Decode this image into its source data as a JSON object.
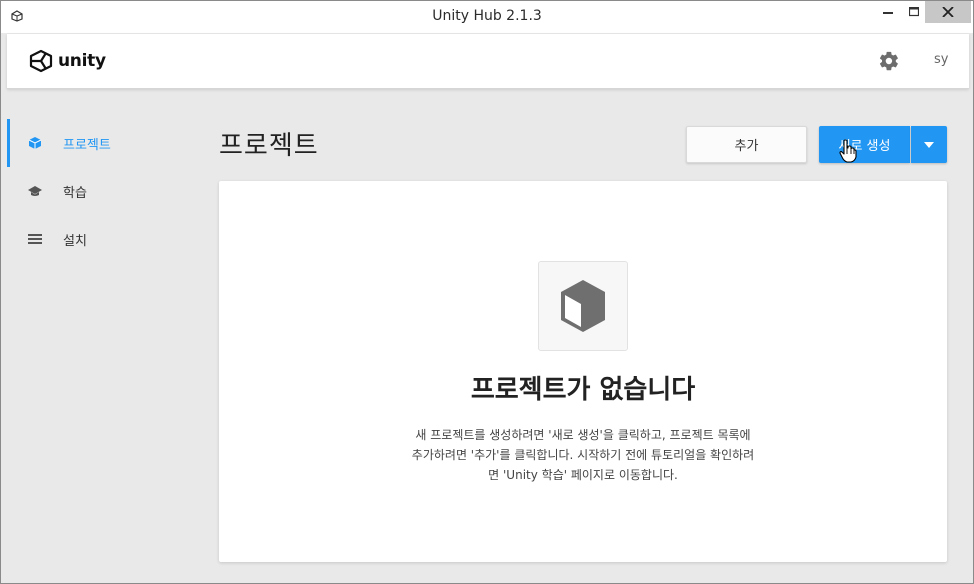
{
  "window": {
    "title": "Unity Hub 2.1.3"
  },
  "header": {
    "logo_text": "unity",
    "user_initials": "sy"
  },
  "sidebar": {
    "items": [
      {
        "label": "프로젝트",
        "icon": "cube-icon",
        "active": true
      },
      {
        "label": "학습",
        "icon": "graduation-cap-icon",
        "active": false
      },
      {
        "label": "설치",
        "icon": "list-icon",
        "active": false
      }
    ]
  },
  "main": {
    "title": "프로젝트",
    "add_button_label": "추가",
    "new_button_label": "새로 생성"
  },
  "empty_state": {
    "title": "프로젝트가 없습니다",
    "description_line1": "새 프로젝트를 생성하려면 '새로 생성'을 클릭하고, 프로젝트 목록에",
    "description_line2": "추가하려면 '추가'를 클릭합니다. 시작하기 전에 튜토리얼을 확인하려",
    "description_line3": "면 'Unity 학습' 페이지로 이동합니다."
  },
  "colors": {
    "accent": "#2196f3",
    "background": "#e9e9e9",
    "panel": "#ffffff"
  }
}
